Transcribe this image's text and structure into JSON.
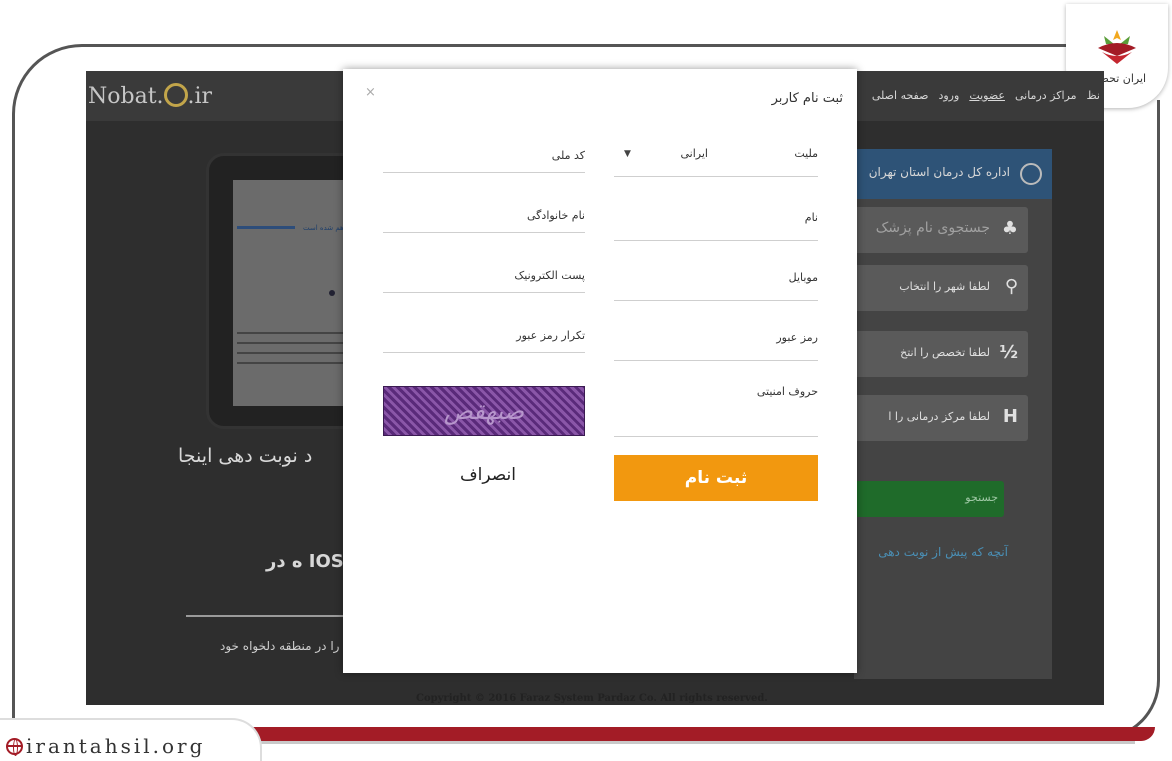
{
  "watermark": {
    "site_url": "irantahsil.org",
    "logo_text": "ایران تحصیل"
  },
  "background_site": {
    "brand": "Nobat.",
    "brand_suffix": ".ir",
    "nav": [
      "صفحه اصلی",
      "ورود",
      "عضویت",
      "مراکز درمانی",
      "نظ"
    ],
    "tablet_caption": "نوبت دهی زیر فراهم شده است",
    "left_heading": "د نوبت دهی اینجا",
    "left_ios": "IOS ه در",
    "left_subtext": "را در منطقه دلخواه خود",
    "panel_header": "اداره کل درمان استان تهران",
    "search_placeholder": "جستجوی نام پزشک",
    "panel_items": [
      {
        "icon": "location-pin-icon",
        "glyph": "⚲",
        "label": "لطفا شهر را انتخاب"
      },
      {
        "icon": "specialty-icon",
        "glyph": "½",
        "label": "لطفا تخصص را انتخ"
      },
      {
        "icon": "hospital-icon",
        "glyph": "H",
        "label": "لطفا مرکز درمانی را ا"
      }
    ],
    "green_button": "جستجو",
    "panel_link": "آنچه که پیش از نوبت دهی",
    "copyright": "Copyright © 2016 Faraz System Pardaz Co. All rights reserved."
  },
  "modal": {
    "title": "ثبت نام کاربر",
    "close": "×",
    "fields": {
      "nationality_label": "ملیت",
      "nationality_value": "ایرانی",
      "national_code_label": "کد ملی",
      "first_name_label": "نام",
      "last_name_label": "نام خانوادگی",
      "mobile_label": "موبایل",
      "email_label": "پست الکترونیک",
      "password_label": "رمز عبور",
      "password_repeat_label": "تکرار رمز عبور",
      "captcha_label": "حروف امنیتی"
    },
    "captcha_text": "صبهقص",
    "submit_label": "ثبت نام",
    "cancel_label": "انصراف"
  }
}
